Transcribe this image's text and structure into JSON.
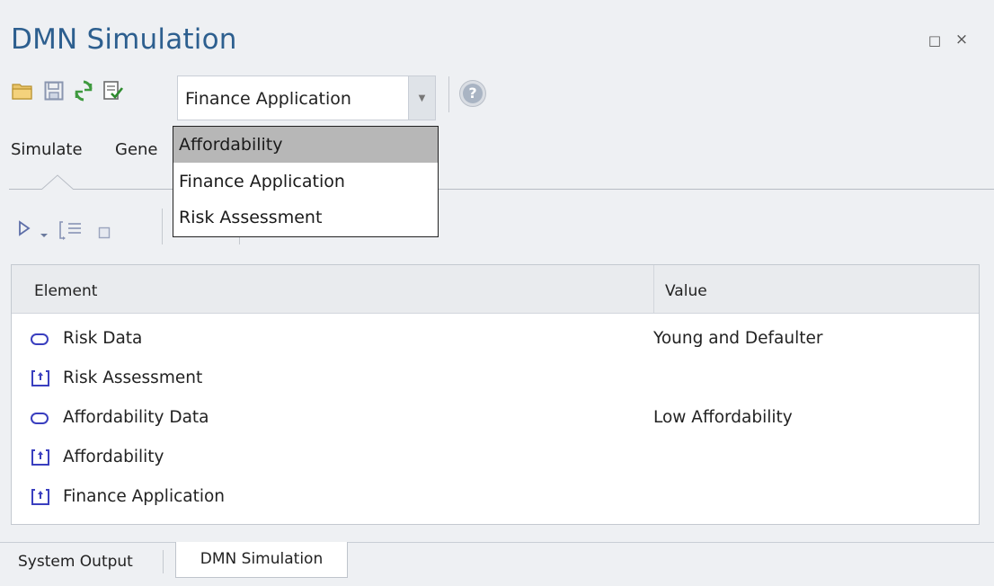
{
  "window": {
    "title": "DMN Simulation",
    "restore_glyph": "□",
    "close_glyph": "×"
  },
  "toolbar": {
    "icons": [
      "open-folder-icon",
      "save-icon",
      "refresh-icon",
      "validate-icon"
    ],
    "combo_value": "Finance Application",
    "help_glyph": "?"
  },
  "tabs": {
    "simulate": "Simulate",
    "generate_partial": "Gene"
  },
  "dropdown": {
    "options": [
      "Affordability",
      "Finance Application",
      "Risk Assessment"
    ],
    "highlighted_index": 0
  },
  "table": {
    "headers": {
      "element": "Element",
      "value": "Value"
    },
    "rows": [
      {
        "type": "data",
        "label": "Risk Data",
        "value": "Young and Defaulter"
      },
      {
        "type": "decision",
        "label": "Risk Assessment",
        "value": ""
      },
      {
        "type": "data",
        "label": "Affordability Data",
        "value": "Low Affordability"
      },
      {
        "type": "decision",
        "label": "Affordability",
        "value": ""
      },
      {
        "type": "decision",
        "label": "Finance Application",
        "value": ""
      }
    ]
  },
  "bottom_tabs": {
    "system_output": "System Output",
    "dmn_simulation": "DMN Simulation"
  },
  "colors": {
    "title": "#2d5f8f",
    "icon_blue": "#3a3fbf",
    "selection": "#b7b7b7"
  }
}
